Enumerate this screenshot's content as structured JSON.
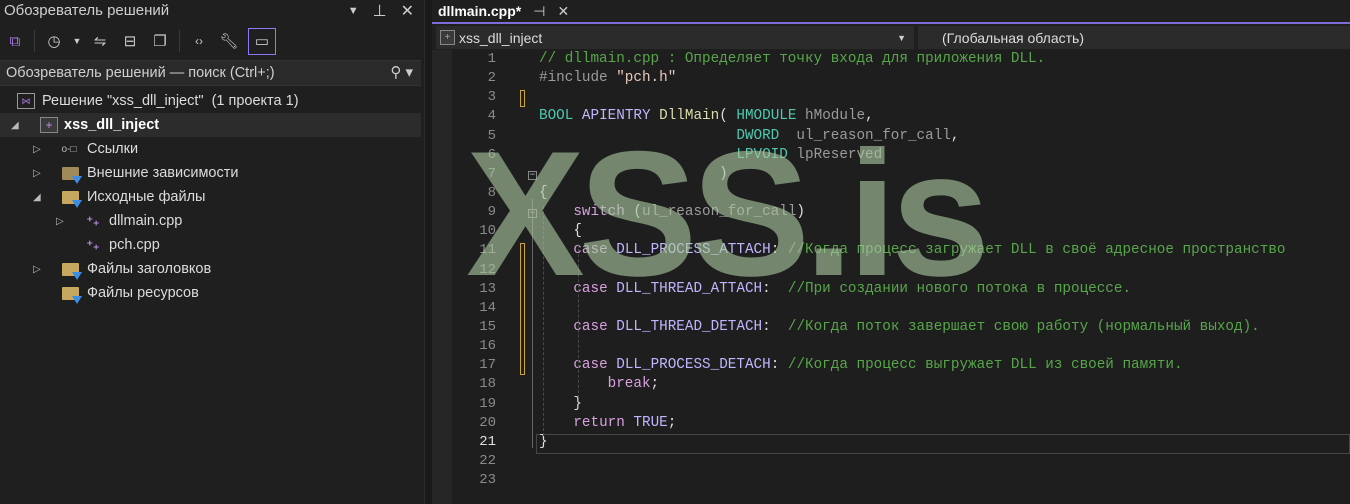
{
  "solution_explorer": {
    "title": "Обозреватель решений",
    "search_placeholder": "Обозреватель решений — поиск (Ctrl+;)",
    "toolbar_icons": [
      "vs-solution-icon",
      "history-icon",
      "dropdown-icon",
      "sync-icon",
      "collapse-all-icon",
      "copy-icon",
      "code-view-icon",
      "properties-icon",
      "preview-icon"
    ],
    "tree": [
      {
        "label": "Решение \"xss_dll_inject\"  (1 проекта 1)",
        "icon": "solution-icon"
      },
      {
        "label": "xss_dll_inject",
        "icon": "cpp-project-icon",
        "expanded": true,
        "selected": true
      },
      {
        "label": "Ссылки",
        "icon": "references-icon",
        "expanded": false
      },
      {
        "label": "Внешние зависимости",
        "icon": "external-deps-icon",
        "expanded": false
      },
      {
        "label": "Исходные файлы",
        "icon": "filter-folder-icon",
        "expanded": true
      },
      {
        "label": "dllmain.cpp",
        "icon": "cpp-file-icon",
        "expanded": false
      },
      {
        "label": "pch.cpp",
        "icon": "cpp-file-icon"
      },
      {
        "label": "Файлы заголовков",
        "icon": "filter-folder-icon",
        "expanded": false
      },
      {
        "label": "Файлы ресурсов",
        "icon": "filter-folder-icon"
      }
    ]
  },
  "editor": {
    "tab": {
      "label": "dllmain.cpp*"
    },
    "project_dropdown": "xss_dll_inject",
    "scope_dropdown": "(Глобальная область)",
    "current_line": 21,
    "watermark": "XSS.is",
    "lines": [
      [
        [
          "// dllmain.cpp : Определяет точку входа для приложения DLL.",
          "cm"
        ]
      ],
      [
        [
          "#include ",
          "pp"
        ],
        [
          "\"pch.h\"",
          "str"
        ]
      ],
      [],
      [
        [
          "BOOL",
          "kw"
        ],
        [
          " ",
          "pl"
        ],
        [
          "APIENTRY",
          "mac"
        ],
        [
          " ",
          "pl"
        ],
        [
          "DllMain",
          "fn"
        ],
        [
          "( ",
          "pl"
        ],
        [
          "HMODULE",
          "kw"
        ],
        [
          " ",
          "pl"
        ],
        [
          "hModule",
          "par"
        ],
        [
          ",",
          "pl"
        ]
      ],
      [
        [
          "                       ",
          "pl"
        ],
        [
          "DWORD",
          "kw"
        ],
        [
          "  ",
          "pl"
        ],
        [
          "ul_reason_for_call",
          "par"
        ],
        [
          ",",
          "pl"
        ]
      ],
      [
        [
          "                       ",
          "pl"
        ],
        [
          "LPVOID",
          "kw"
        ],
        [
          " ",
          "pl"
        ],
        [
          "lpReserved",
          "par"
        ]
      ],
      [
        [
          "                     )",
          "pl"
        ]
      ],
      [
        [
          "{",
          "pl"
        ]
      ],
      [
        [
          "    ",
          "pl"
        ],
        [
          "switch",
          "ctl"
        ],
        [
          " (",
          "pl"
        ],
        [
          "ul_reason_for_call",
          "par"
        ],
        [
          ")",
          "pl"
        ]
      ],
      [
        [
          "    {",
          "pl"
        ]
      ],
      [
        [
          "    ",
          "pl"
        ],
        [
          "case",
          "ctl"
        ],
        [
          " ",
          "pl"
        ],
        [
          "DLL_PROCESS_ATTACH",
          "mac"
        ],
        [
          ": ",
          "pl"
        ],
        [
          "//Когда процесс загружает DLL в своё адресное пространство",
          "cm"
        ]
      ],
      [],
      [
        [
          "    ",
          "pl"
        ],
        [
          "case",
          "ctl"
        ],
        [
          " ",
          "pl"
        ],
        [
          "DLL_THREAD_ATTACH",
          "mac"
        ],
        [
          ":  ",
          "pl"
        ],
        [
          "//При создании нового потока в процессе.",
          "cm"
        ]
      ],
      [],
      [
        [
          "    ",
          "pl"
        ],
        [
          "case",
          "ctl"
        ],
        [
          " ",
          "pl"
        ],
        [
          "DLL_THREAD_DETACH",
          "mac"
        ],
        [
          ":  ",
          "pl"
        ],
        [
          "//Когда поток завершает свою работу (нормальный выход).",
          "cm"
        ]
      ],
      [],
      [
        [
          "    ",
          "pl"
        ],
        [
          "case",
          "ctl"
        ],
        [
          " ",
          "pl"
        ],
        [
          "DLL_PROCESS_DETACH",
          "mac"
        ],
        [
          ": ",
          "pl"
        ],
        [
          "//Когда процесс выгружает DLL из своей памяти.",
          "cm"
        ]
      ],
      [
        [
          "        ",
          "pl"
        ],
        [
          "break",
          "ctl"
        ],
        [
          ";",
          "pl"
        ]
      ],
      [
        [
          "    }",
          "pl"
        ]
      ],
      [
        [
          "    ",
          "pl"
        ],
        [
          "return",
          "ctl"
        ],
        [
          " ",
          "pl"
        ],
        [
          "TRUE",
          "mac"
        ],
        [
          ";",
          "pl"
        ]
      ],
      [
        [
          "}",
          "pl"
        ]
      ],
      [],
      []
    ]
  }
}
